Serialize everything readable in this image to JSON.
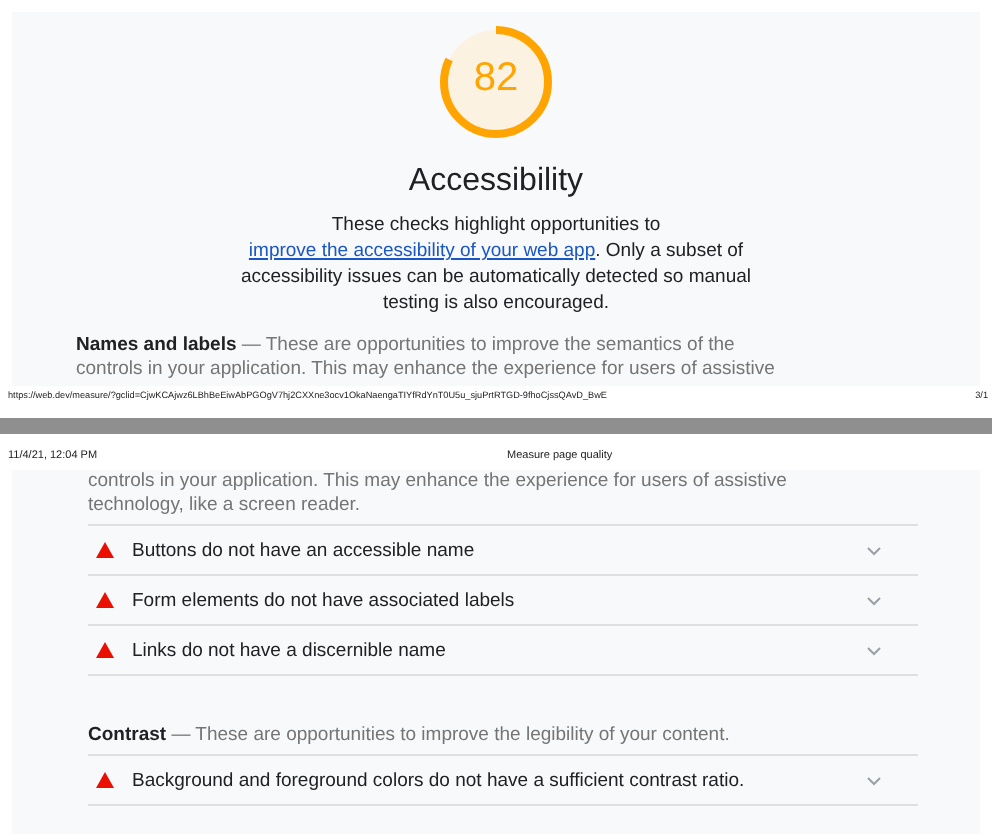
{
  "page1": {
    "score": {
      "value": "82",
      "level": 0.82
    },
    "title": "Accessibility",
    "description": {
      "before": "These checks highlight opportunities to ",
      "link": "improve the accessibility of your web app",
      "after": ". Only a subset of accessibility issues can be automatically detected so manual testing is also encouraged."
    },
    "group_lines": [
      "**Names and labels** — These are opportunities to improve the semantics of the",
      "controls in your application. This may enhance the experience for users of assistive"
    ],
    "footer": {
      "url": "https://web.dev/measure/?gclid=CjwKCAjwz6LBhBeEiwAbPGOgV7hj2CXXne3ocv1OkaNaengaTIYfRdYnT0U5u_sjuPrtRTGD-9fhoCjssQAvD_BwE",
      "page": "3/1"
    }
  },
  "page2": {
    "header": {
      "date": "11/4/21, 12:04 PM",
      "title": "Measure page quality"
    },
    "continued_lines": [
      "controls in your application. This may enhance the experience for users of assistive",
      "technology, like a screen reader."
    ],
    "audits": [
      {
        "kind": "fail",
        "title": "Buttons do not have an accessible name"
      },
      {
        "kind": "fail",
        "title": "Form elements do not have associated labels"
      },
      {
        "kind": "fail",
        "title": "Links do not have a discernible name"
      }
    ],
    "group2": "**Contrast** — These are opportunities to improve the legibility of your content.",
    "audits2": [
      {
        "kind": "fail",
        "title": "Background and foreground colors do not have a sufficient contrast ratio."
      }
    ]
  }
}
